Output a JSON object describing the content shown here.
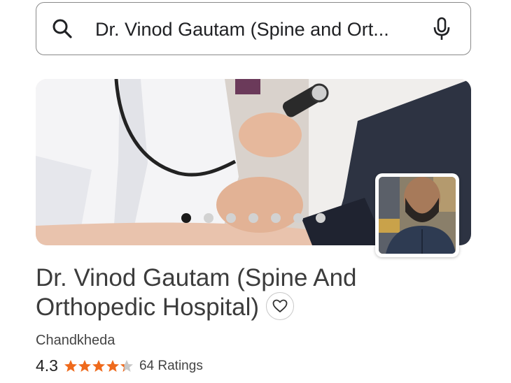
{
  "search": {
    "query": "Dr. Vinod Gautam (Spine and Ort..."
  },
  "icons": {
    "search": "search-icon",
    "mic": "microphone-icon",
    "favorite": "heart-outline-icon",
    "star": "star-icon"
  },
  "carousel": {
    "total_slides": 7,
    "active_index": 0
  },
  "business": {
    "title_line1": "Dr. Vinod Gautam (Spine And",
    "title_line2": "Orthopedic Hospital)",
    "locality": "Chandkheda",
    "rating": "4.3",
    "rating_value": 4.3,
    "max_stars": 5,
    "ratings_count": "64 Ratings"
  },
  "colors": {
    "star": "#ef6a1c",
    "star_empty": "#c8c8c8",
    "active_dot": "#1a1a1a",
    "inactive_dot": "#d2d2d2"
  }
}
